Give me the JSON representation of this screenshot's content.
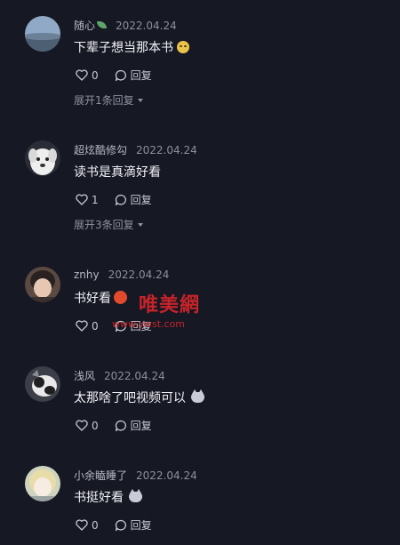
{
  "comments": [
    {
      "username": "随心",
      "date": "2022.04.24",
      "text": "下辈子想当那本书",
      "likes": "0",
      "reply_label": "回复",
      "expand_label": "展开1条回复",
      "emoji": "smiling-face-emoji",
      "name_emoji": "leaf-emoji"
    },
    {
      "username": "超炫酷修勾",
      "date": "2022.04.24",
      "text": "读书是真滴好看",
      "likes": "1",
      "reply_label": "回复",
      "expand_label": "展开3条回复"
    },
    {
      "username": "znhy",
      "date": "2022.04.24",
      "text": "书好看",
      "likes": "0",
      "reply_label": "回复",
      "emoji": "red-emoji"
    },
    {
      "username": "浅风",
      "date": "2022.04.24",
      "text": "太那啥了吧视频可以",
      "likes": "0",
      "reply_label": "回复",
      "emoji": "cat-emoji"
    },
    {
      "username": "小余瞌睡了",
      "date": "2022.04.24",
      "text": "书挺好看",
      "likes": "0",
      "reply_label": "回复",
      "emoji": "cat-emoji"
    }
  ],
  "watermark": {
    "text": "唯美網",
    "url": "www.ywst.com"
  },
  "colors": {
    "background": "#161824",
    "text_primary": "#f2f2f6",
    "text_secondary": "#a6a8b4",
    "watermark": "#d8262a"
  }
}
